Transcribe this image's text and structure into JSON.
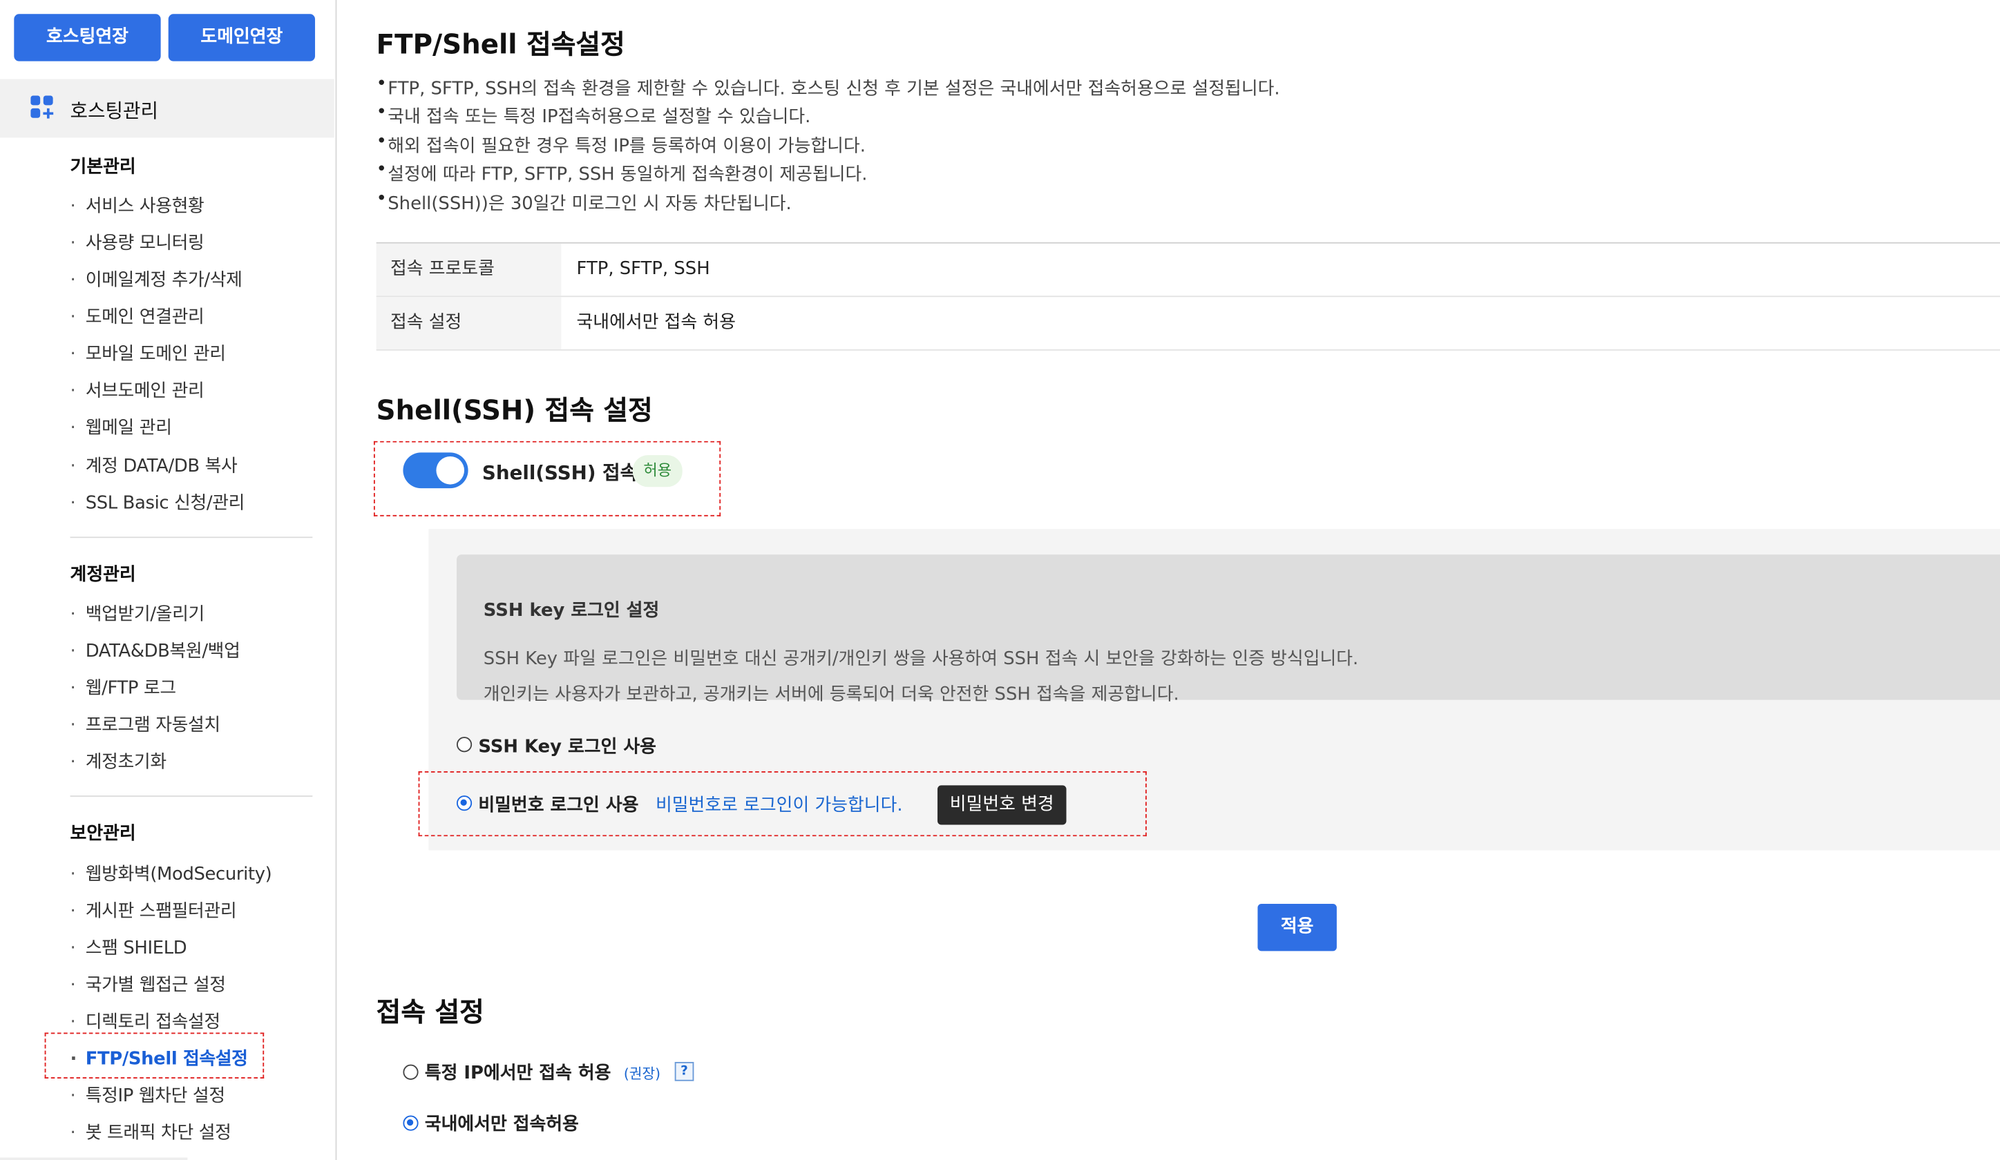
{
  "top_buttons": {
    "hosting_extend": "호스팅연장",
    "domain_extend": "도메인연장"
  },
  "sidebar": {
    "header": "호스팅관리",
    "header_icon": "grid-plus-icon",
    "sections": [
      {
        "title": "기본관리",
        "items": [
          "서비스 사용현황",
          "사용량 모니터링",
          "이메일계정 추가/삭제",
          "도메인 연결관리",
          "모바일 도메인 관리",
          "서브도메인 관리",
          "웹메일 관리",
          "계정 DATA/DB 복사",
          "SSL Basic 신청/관리"
        ]
      },
      {
        "title": "계정관리",
        "items": [
          "백업받기/올리기",
          "DATA&DB복원/백업",
          "웹/FTP 로그",
          "프로그램 자동설치",
          "계정초기화"
        ]
      },
      {
        "title": "보안관리",
        "items": [
          "웹방화벽(ModSecurity)",
          "게시판 스팸필터관리",
          "스팸 SHIELD",
          "국가별 웹접근 설정",
          "디렉토리 접속설정",
          "FTP/Shell 접속설정",
          "특정IP 웹차단 설정",
          "봇 트래픽 차단 설정"
        ]
      }
    ],
    "active_item": "FTP/Shell 접속설정"
  },
  "main": {
    "title": "FTP/Shell 접속설정",
    "bullets": [
      "FTP, SFTP, SSH의 접속 환경을 제한할 수 있습니다. 호스팅 신청 후 기본 설정은 국내에서만 접속허용으로 설정됩니다.",
      "국내 접속 또는 특정 IP접속허용으로 설정할 수 있습니다.",
      "해외 접속이 필요한 경우 특정 IP를 등록하여 이용이 가능합니다.",
      "설정에 따라 FTP, SFTP, SSH 동일하게 접속환경이 제공됩니다.",
      "Shell(SSH))은 30일간 미로그인 시 자동 차단됩니다."
    ],
    "table": [
      {
        "label": "접속 프로토콜",
        "value": "FTP, SFTP, SSH"
      },
      {
        "label": "접속 설정",
        "value": "국내에서만 접속 허용"
      }
    ],
    "ssh_section": {
      "title": "Shell(SSH) 접속 설정",
      "toggle_label": "Shell(SSH) 접속",
      "toggle_on": true,
      "badge": "허용",
      "key_title": "SSH key 로그인 설정",
      "key_desc": [
        "SSH Key 파일 로그인은 비밀번호 대신 공개키/개인키 쌍을 사용하여 SSH 접속 시 보안을 강화하는 인증 방식입니다.",
        "개인키는 사용자가 보관하고, 공개키는 서버에 등록되어 더욱 안전한 SSH 접속을 제공합니다."
      ],
      "option_key": "SSH Key 로그인 사용",
      "option_password": "비밀번호 로그인 사용",
      "password_hint": "비밀번호로 로그인이 가능합니다.",
      "password_change": "비밀번호 변경",
      "selected": "비밀번호 로그인 사용"
    },
    "apply": "적용",
    "access_section": {
      "title": "접속 설정",
      "option_ip": "특정 IP에서만 접속 허용",
      "recommend": "(권장)",
      "help": "?",
      "option_domestic": "국내에서만 접속허용",
      "selected": "국내에서만 접속허용"
    }
  },
  "colors": {
    "accent": "#2f6fe4",
    "link": "#1a66d0",
    "badge_bg": "#e9f6e6",
    "badge_text": "#2e8b3a",
    "highlight_border": "#e02020"
  }
}
